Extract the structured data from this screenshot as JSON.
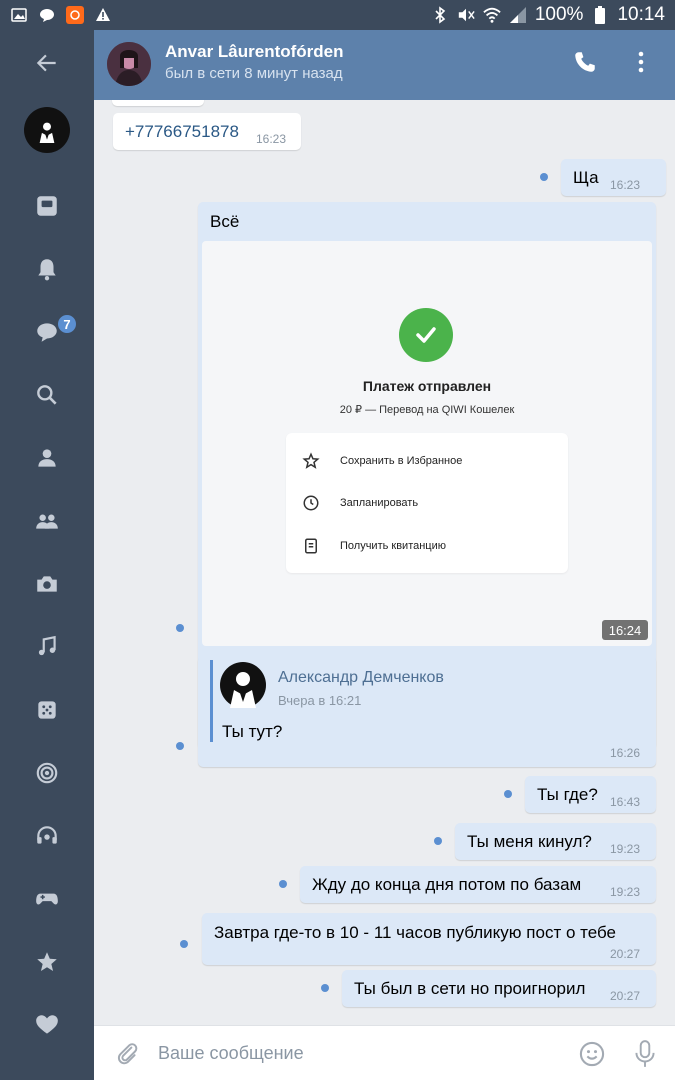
{
  "status_bar": {
    "battery": "100%",
    "time": "10:14"
  },
  "header": {
    "peer_name": "Anvar Lâurentofórden",
    "peer_status": "был в сети 8 минут назад"
  },
  "sidebar": {
    "badge_count": "7"
  },
  "messages": {
    "m1": {
      "text": "+77766751878",
      "time": "16:23"
    },
    "m2": {
      "text": "Ща",
      "time": "16:23"
    },
    "m3": {
      "text": "Всё",
      "time": "16:24",
      "payment": {
        "title": "Платеж отправлен",
        "subtitle": "20 ₽ — Перевод на QIWI Кошелек",
        "actions": [
          "Сохранить в Избранное",
          "Запланировать",
          "Получить квитанцию"
        ]
      }
    },
    "m4": {
      "forward_author": "Александр Демченков",
      "forward_date": "Вчера в 16:21",
      "text": "Ты тут?",
      "time": "16:26"
    },
    "m5": {
      "text": "Ты где?",
      "time": "16:43"
    },
    "m6": {
      "text": "Ты меня кинул?",
      "time": "19:23"
    },
    "m7": {
      "text": "Жду до конца дня потом по базам",
      "time": "19:23"
    },
    "m8": {
      "text": "Завтра где-то в 10 - 11 часов публикую пост о тебе",
      "time": "20:27"
    },
    "m9": {
      "text": "Ты был в сети но проигнорил",
      "time": "20:27"
    }
  },
  "input": {
    "placeholder": "Ваше сообщение"
  }
}
